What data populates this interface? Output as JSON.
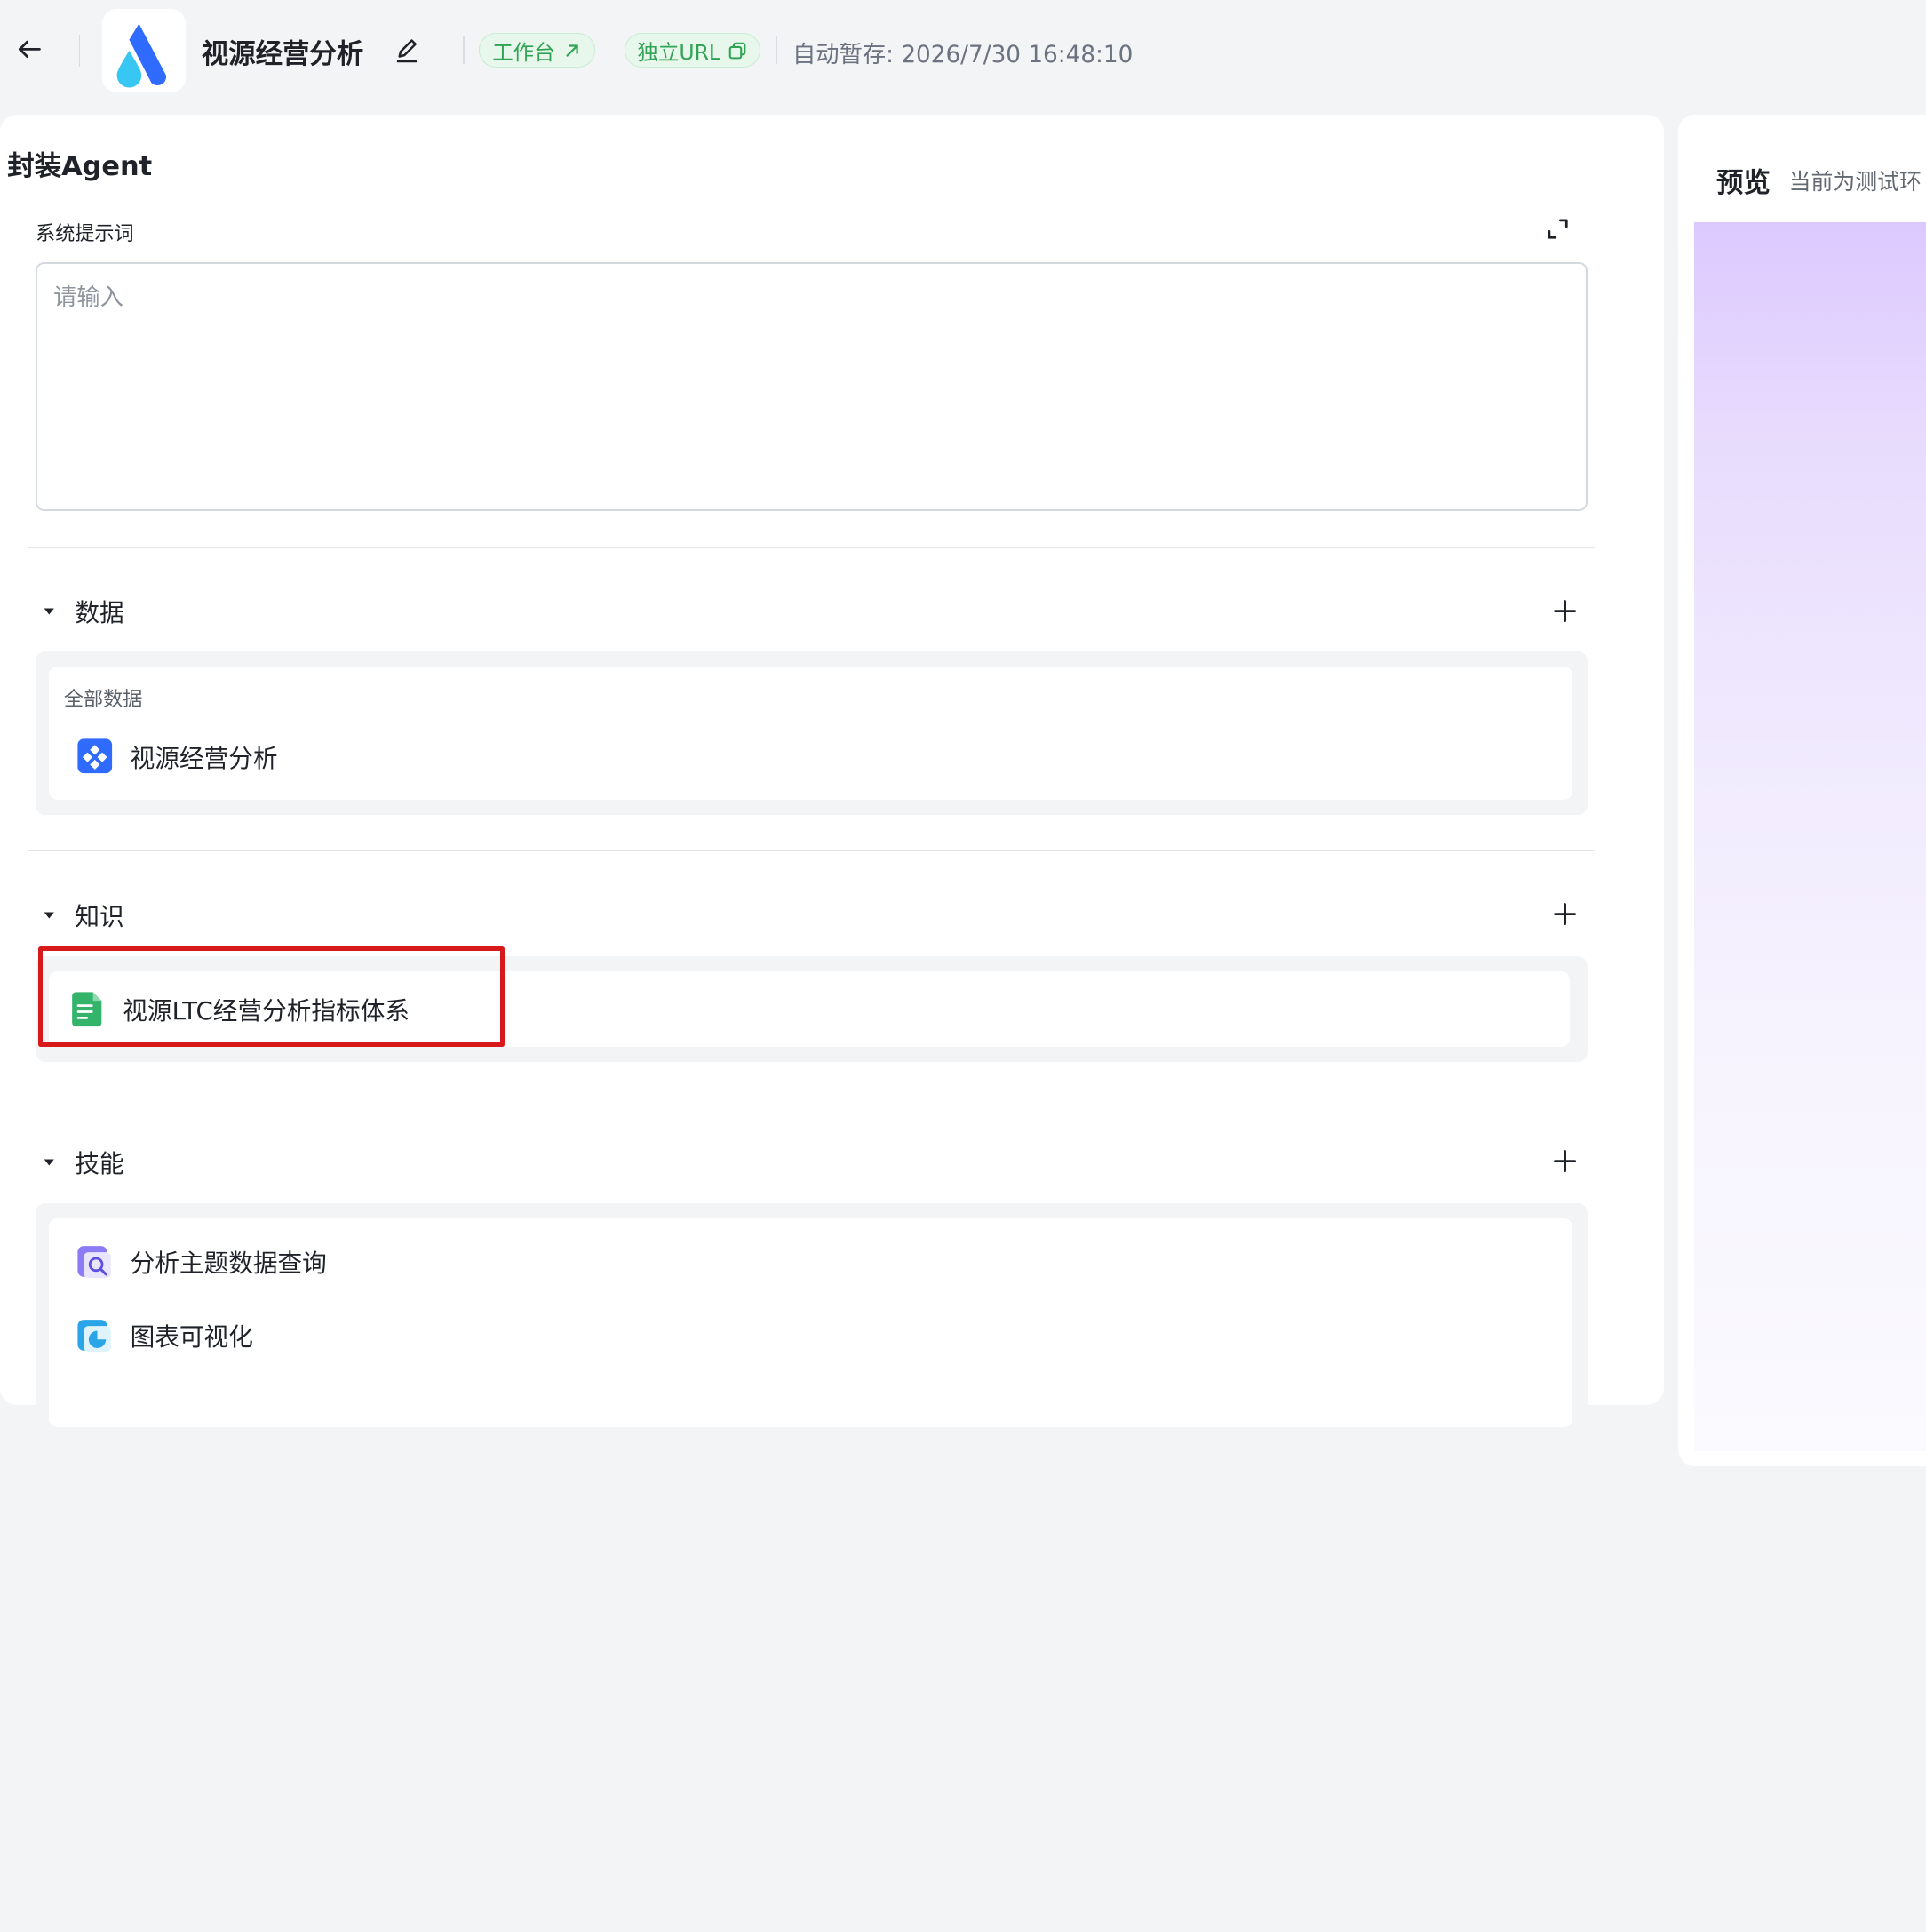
{
  "header": {
    "app_title": "视源经营分析",
    "workbench_label": "工作台",
    "standalone_url_label": "独立URL",
    "autosave_label": "自动暂存:",
    "autosave_time": "2026/7/30 16:48:10"
  },
  "agent": {
    "section_title": "封装Agent",
    "prompt_label": "系统提示词",
    "prompt_placeholder": "请输入",
    "prompt_value": ""
  },
  "groups": {
    "data": {
      "label": "数据",
      "subheading": "全部数据",
      "items": [
        {
          "label": "视源经营分析",
          "icon": "dataset-icon"
        }
      ]
    },
    "knowledge": {
      "label": "知识",
      "items": [
        {
          "label": "视源LTC经营分析指标体系",
          "icon": "document-icon"
        }
      ]
    },
    "skills": {
      "label": "技能",
      "items": [
        {
          "label": "分析主题数据查询",
          "icon": "data-query-icon"
        },
        {
          "label": "图表可视化",
          "icon": "chart-visualization-icon"
        }
      ]
    }
  },
  "preview": {
    "title": "预览",
    "note": "当前为测试环"
  },
  "colors": {
    "accent_green": "#31a354",
    "highlight_red": "#d7191c",
    "brand_blue": "#2f6bff"
  }
}
